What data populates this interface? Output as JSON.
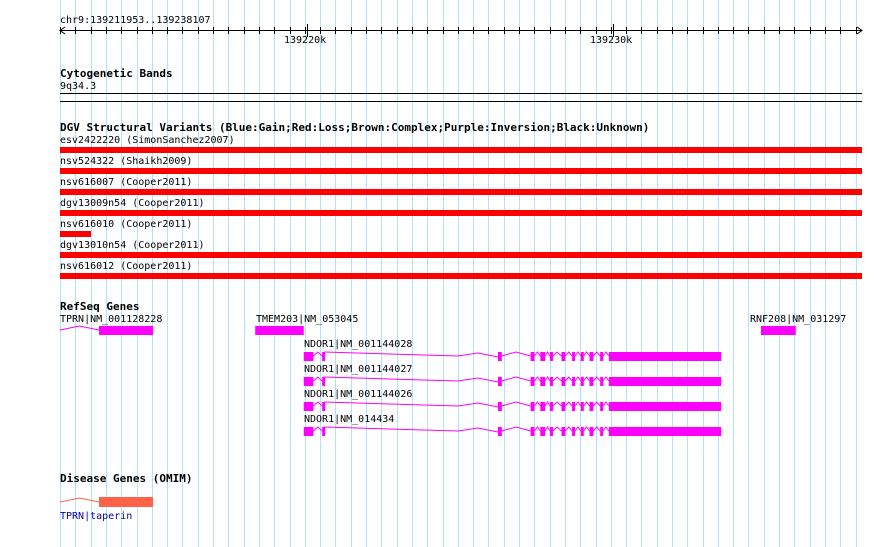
{
  "ruler": {
    "range_label": "chr9:139211953..139238107",
    "ticks": [
      {
        "label": "139220k",
        "pos": 139220000
      },
      {
        "label": "139230k",
        "pos": 139230000
      }
    ]
  },
  "tracks": {
    "cytoband": {
      "title": "Cytogenetic Bands",
      "band": "9q34.3"
    },
    "dgv": {
      "title": "DGV Structural Variants (Blue:Gain;Red:Loss;Brown:Complex;Purple:Inversion;Black:Unknown)",
      "color": "#ff0000",
      "items": [
        {
          "label": "esv2422220 (SimonSanchez2007)",
          "start": 139211953,
          "end": 139238107
        },
        {
          "label": "nsv524322 (Shaikh2009)",
          "start": 139211953,
          "end": 139238107
        },
        {
          "label": "nsv616007 (Cooper2011)",
          "start": 139211953,
          "end": 139238107
        },
        {
          "label": "dgv13009n54 (Cooper2011)",
          "start": 139211953,
          "end": 139238107
        },
        {
          "label": "nsv616010 (Cooper2011)",
          "start": 139211953,
          "end": 139212963
        },
        {
          "label": "dgv13010n54 (Cooper2011)",
          "start": 139211953,
          "end": 139238107
        },
        {
          "label": "nsv616012 (Cooper2011)",
          "start": 139211953,
          "end": 139238107
        }
      ]
    },
    "refseq": {
      "title": "RefSeq Genes",
      "color": "#ff00ff",
      "genes": [
        {
          "label": "TPRN|NM_001128228",
          "intron_start": 139211953,
          "intron_end": 139213225,
          "exons": [
            [
              139213225,
              139214988
            ]
          ]
        },
        {
          "label": "TMEM203|NM_053045",
          "intron_start": 139218319,
          "intron_end": 139219902,
          "exons": [
            [
              139218319,
              139219902
            ]
          ]
        },
        {
          "label": "RNF208|NM_031297",
          "intron_start": 139234812,
          "intron_end": 139235947,
          "exons": [
            [
              139234812,
              139235947
            ]
          ]
        }
      ],
      "ndor1": [
        {
          "label": "NDOR1|NM_001144028"
        },
        {
          "label": "NDOR1|NM_001144027"
        },
        {
          "label": "NDOR1|NM_001144026"
        },
        {
          "label": "NDOR1|NM_014434"
        }
      ],
      "ndor1_span": [
        139219902,
        139233516
      ],
      "ndor1_exons": [
        [
          139219902,
          139220217
        ],
        [
          139220502,
          139220565
        ],
        [
          139226235,
          139226361
        ],
        [
          139227300,
          139227426
        ],
        [
          139227616,
          139227773
        ],
        [
          139227931,
          139228024
        ],
        [
          139228306,
          139228432
        ],
        [
          139228653,
          139228747
        ],
        [
          139228937,
          139229031
        ],
        [
          139229221,
          139229347
        ],
        [
          139229568,
          139229662
        ],
        [
          139229852,
          139233516
        ]
      ]
    },
    "omim": {
      "title": "Disease Genes (OMIM)",
      "color": "#ff6347",
      "gene_label": "TPRN|taperin",
      "intron_start": 139211953,
      "intron_end": 139213225,
      "exon": [
        139213225,
        139214988
      ]
    }
  }
}
